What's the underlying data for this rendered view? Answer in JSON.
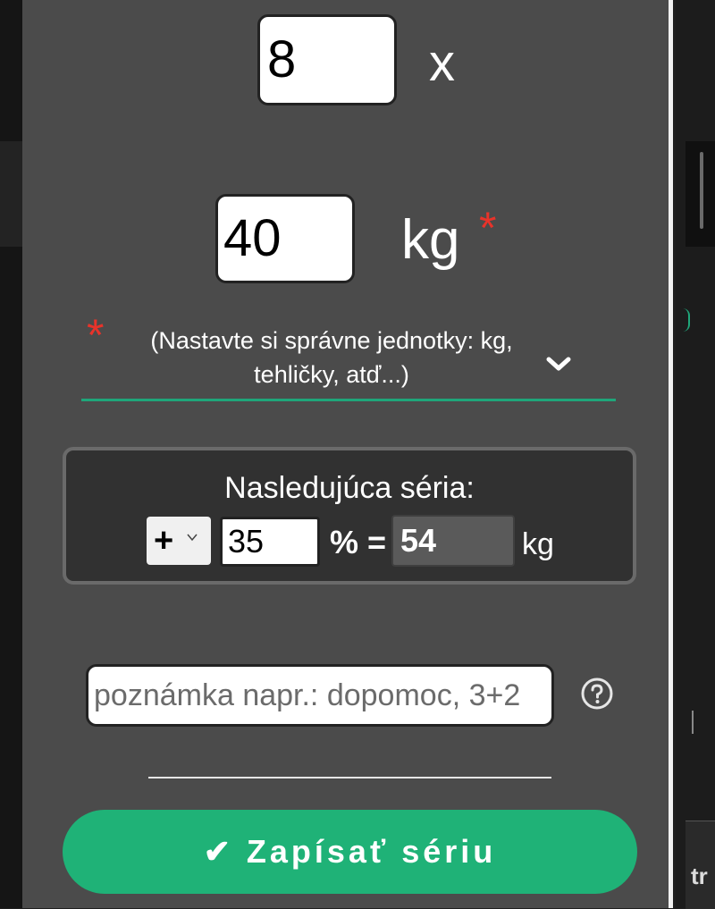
{
  "sets": {
    "reps_value": "8",
    "times_label": "x"
  },
  "weight": {
    "value": "40",
    "unit_label": "kg",
    "required_mark": "*"
  },
  "unit_select": {
    "required_mark": "*",
    "label": "(Nastavte si správne jednotky: kg, tehličky, atď...)",
    "icon": "chevron-down-icon"
  },
  "next_series": {
    "title": "Nasledujúca séria:",
    "operator": "+",
    "percent_value": "35",
    "percent_equals": "% =",
    "result_value": "54",
    "result_unit": "kg"
  },
  "note": {
    "placeholder": "poznámka napr.: dopomoc, 3+2",
    "help_icon": "question-circle-icon"
  },
  "save_button": {
    "label": "✔ Zapísať sériu"
  },
  "background_tab": {
    "text": "tr"
  },
  "colors": {
    "panel": "#4b4b4b",
    "accent_green": "#1fb277",
    "required_red": "#e8332a"
  }
}
